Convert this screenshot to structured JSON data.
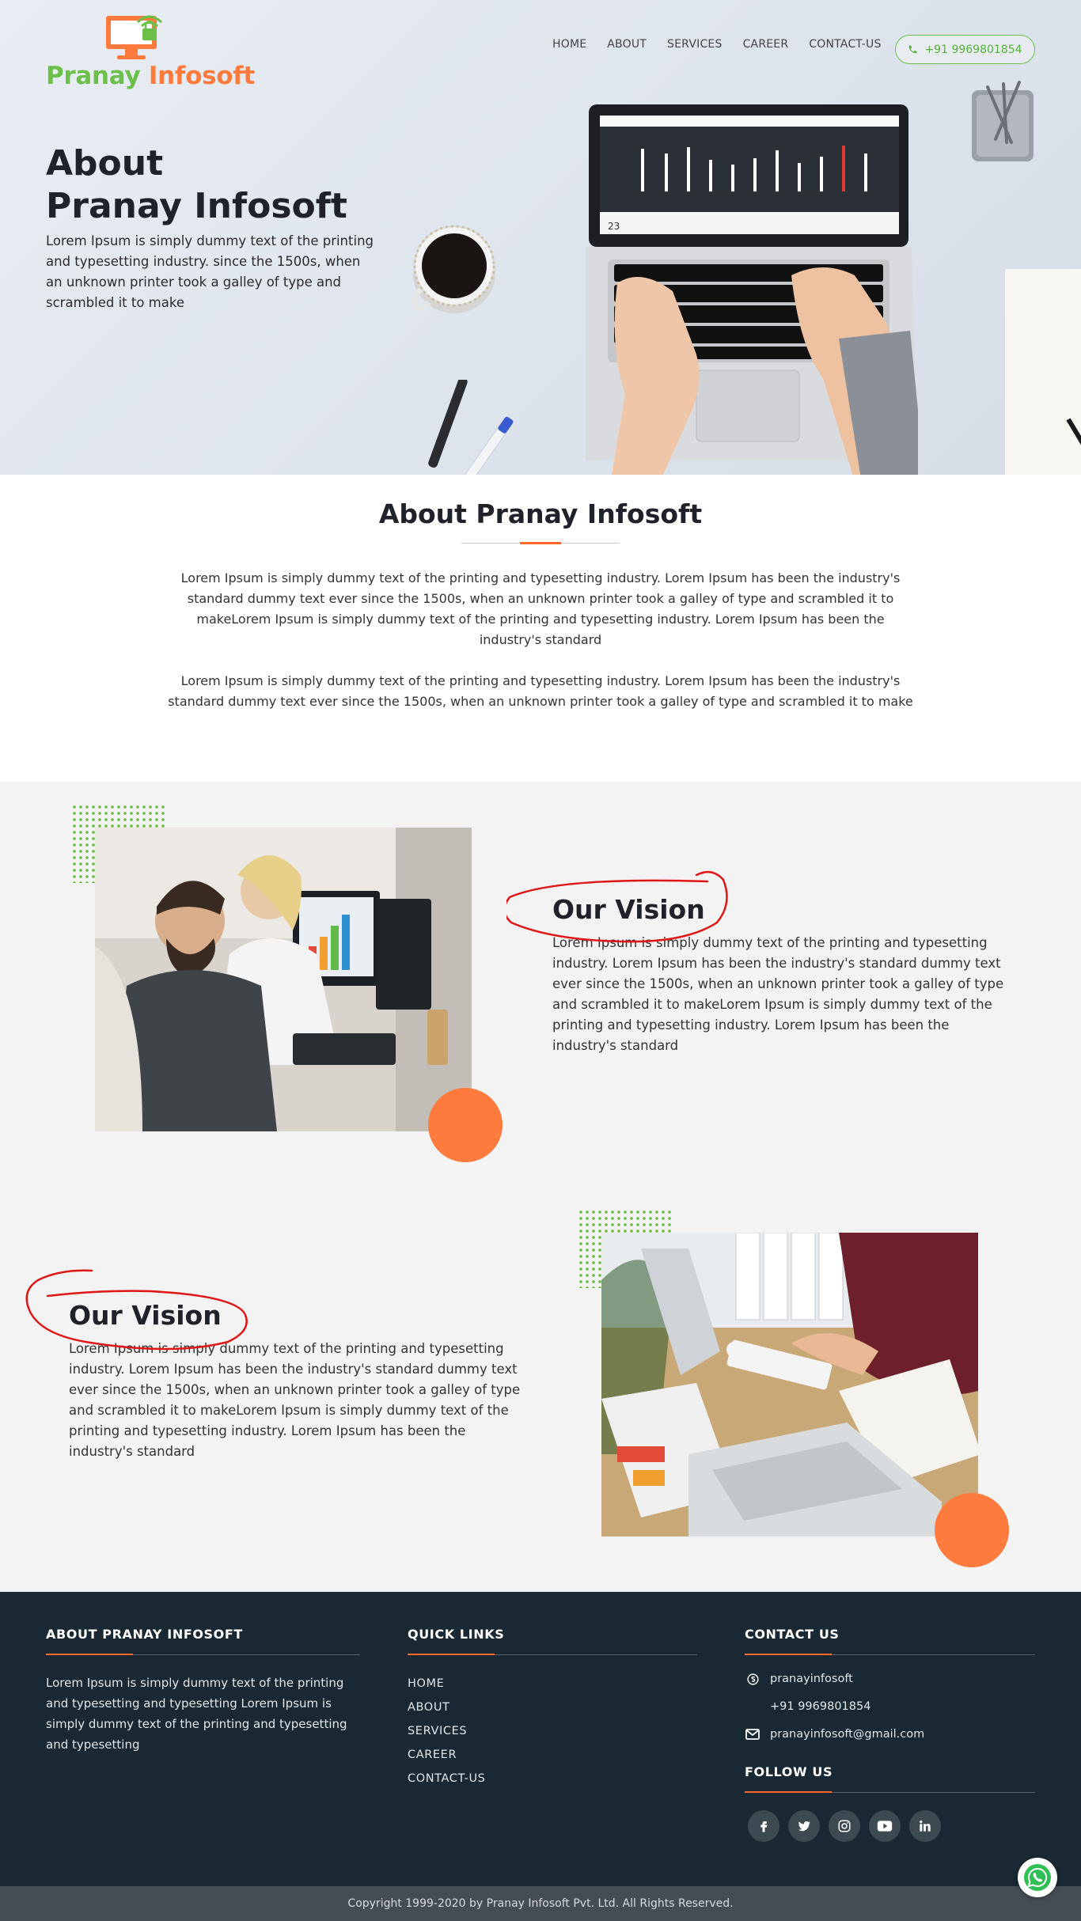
{
  "brand": {
    "name_part1": "Pranay",
    "name_part2": "Infosoft",
    "logo_icon": "monitor-lock-logo",
    "green": "#6cc04a",
    "orange": "#ff7a3d"
  },
  "nav": {
    "items": [
      "HOME",
      "ABOUT",
      "SERVICES",
      "CAREER",
      "CONTACT-US"
    ],
    "phone_label": "+91 9969801854",
    "phone_icon": "phone-icon"
  },
  "hero": {
    "title_line1": "About",
    "title_line2": "Pranay Infosoft",
    "text": "Lorem Ipsum is simply dummy text of the printing and typesetting industry. since the 1500s, when an unknown printer took a galley of type and scrambled it to make"
  },
  "about": {
    "title": "About Pranay Infosoft",
    "paragraph1": "Lorem Ipsum is simply dummy text of the printing and typesetting industry. Lorem Ipsum has been the industry's standard dummy text ever since the 1500s, when an unknown printer took a galley of type and scrambled it to makeLorem Ipsum is simply dummy text of the printing and typesetting industry. Lorem Ipsum has been the industry's standard",
    "paragraph2": "Lorem Ipsum is simply dummy text of the printing and typesetting industry. Lorem Ipsum has been the industry's standard dummy text ever since the 1500s, when an unknown printer took a galley of type and scrambled it to make"
  },
  "vision": [
    {
      "title": "Our Vision",
      "text": "Lorem Ipsum is simply dummy text of the printing and typesetting industry. Lorem Ipsum has been the industry's standard dummy text ever since the 1500s, when an unknown printer took a galley of type and scrambled it to makeLorem Ipsum is simply dummy text of the printing and typesetting industry. Lorem Ipsum has been the industry's standard"
    },
    {
      "title": "Our Vision",
      "text": "Lorem Ipsum is simply dummy text of the printing and typesetting industry. Lorem Ipsum has been the industry's standard dummy text ever since the 1500s, when an unknown printer took a galley of type and scrambled it to makeLorem Ipsum is simply dummy text of the printing and typesetting industry. Lorem Ipsum has been the industry's standard"
    }
  ],
  "footer": {
    "about_heading": "ABOUT PRANAY INFOSOFT",
    "about_text": "Lorem Ipsum is simply dummy text of the printing and typesetting and typesetting Lorem Ipsum is simply dummy text of the printing and typesetting and typesetting",
    "links_heading": "QUICK LINKS",
    "links": [
      "HOME",
      "ABOUT",
      "SERVICES",
      "CAREER",
      "CONTACT-US"
    ],
    "contact_heading": "CONTACT US",
    "skype": "pranayinfosoft",
    "phone": "+91 9969801854",
    "email": "pranayinfosoft@gmail.com",
    "follow_heading": "FOLLOW US",
    "socials": [
      "facebook-icon",
      "twitter-icon",
      "instagram-icon",
      "youtube-icon",
      "linkedin-icon"
    ],
    "copyright": "Copyright 1999-2020 by Pranay Infosoft Pvt. Ltd. All Rights Reserved."
  },
  "colors": {
    "footer_bg": "#192832",
    "copyright_bg": "#454d54",
    "accent": "#ff6a2b",
    "section_bg": "#f4f3f3",
    "annotation_red": "#e01515"
  }
}
